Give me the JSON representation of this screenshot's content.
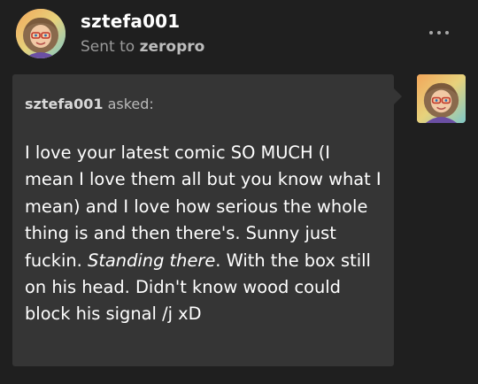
{
  "post": {
    "username": "sztefa001",
    "sent_to_prefix": "Sent to",
    "recipient": "zeropro",
    "more_icon": "more-horizontal-icon"
  },
  "ask": {
    "asker": "sztefa001",
    "asked_label": "asked:",
    "question_part1": "I love your latest comic SO MUCH (I mean I love them all but you know what I mean) and I love how serious the whole thing is and then there's. Sunny just fuckin. ",
    "question_emphasis": "Standing there",
    "question_part2": ". With the box still on his head. Didn't know wood could block his signal /j xD"
  },
  "colors": {
    "background": "#1f1f1f",
    "card": "#353535",
    "muted_text": "#9a9a9a"
  }
}
